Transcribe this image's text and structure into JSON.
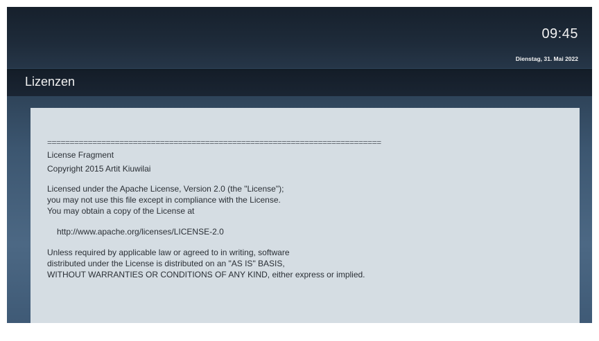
{
  "header": {
    "time": "09:45",
    "date": "Dienstag, 31. Mai 2022"
  },
  "page": {
    "title": "Lizenzen"
  },
  "license": {
    "separator": "==========================================================================",
    "name": "License Fragment",
    "copyright": "Copyright 2015 Artit Kiuwilai",
    "p1_line1": "Licensed under the Apache License, Version 2.0 (the \"License\");",
    "p1_line2": "you may not use this file except in compliance with the License.",
    "p1_line3": "You may obtain a copy of the License at",
    "url": "http://www.apache.org/licenses/LICENSE-2.0",
    "p2_line1": "Unless required by applicable law or agreed to in writing, software",
    "p2_line2": "distributed under the License is distributed on an \"AS IS\" BASIS,",
    "p2_line3": "WITHOUT WARRANTIES OR CONDITIONS OF ANY KIND, either express or implied."
  }
}
